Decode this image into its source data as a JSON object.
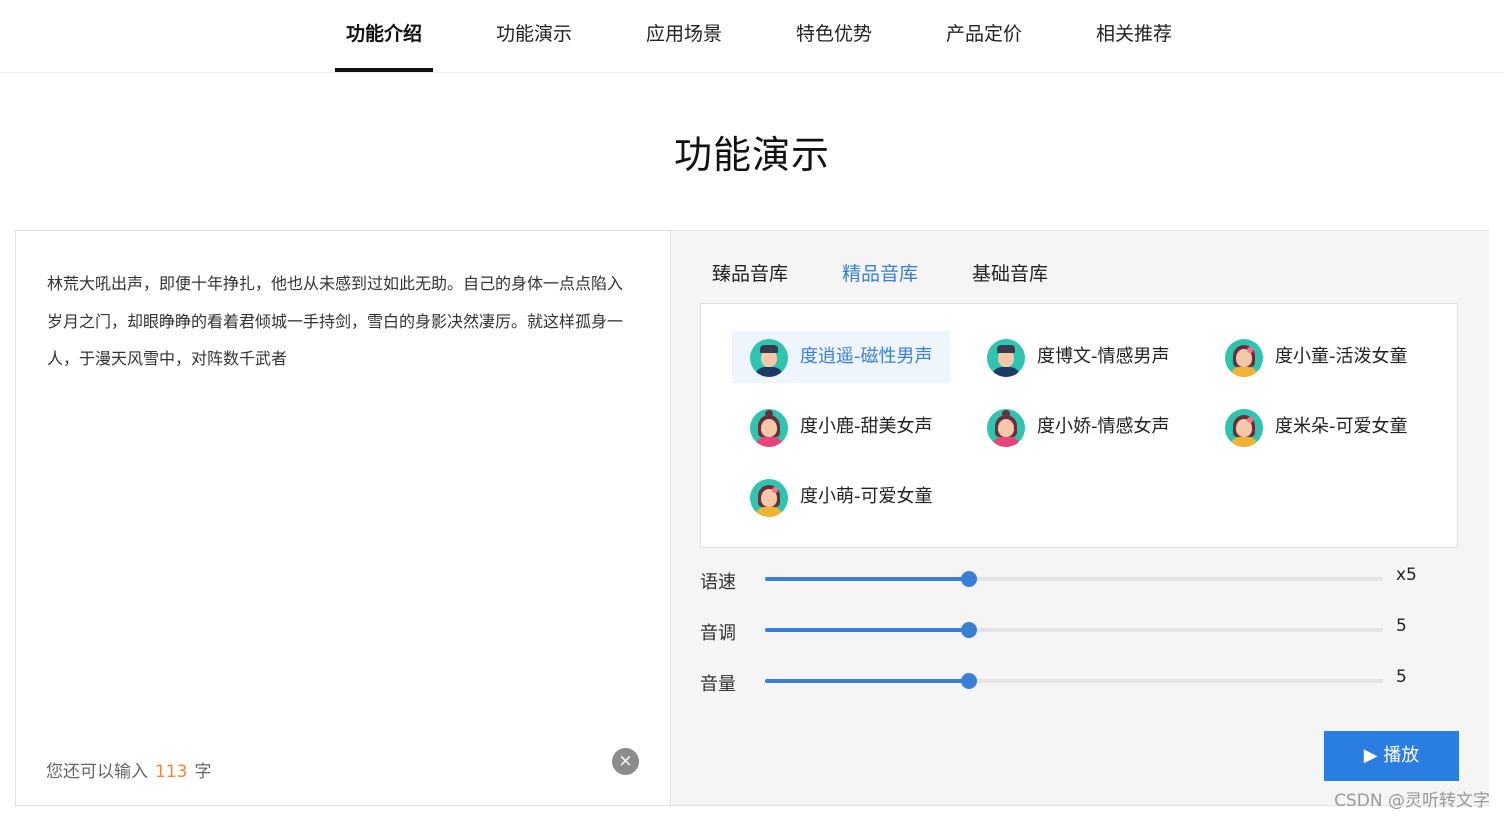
{
  "nav": {
    "items": [
      {
        "label": "功能介绍",
        "active": true
      },
      {
        "label": "功能演示",
        "active": false
      },
      {
        "label": "应用场景",
        "active": false
      },
      {
        "label": "特色优势",
        "active": false
      },
      {
        "label": "产品定价",
        "active": false
      },
      {
        "label": "相关推荐",
        "active": false
      }
    ]
  },
  "section": {
    "title": "功能演示"
  },
  "editor": {
    "text": "林荒大吼出声，即便十年挣扎，他也从未感到过如此无助。自己的身体一点点陷入岁月之门，却眼睁睁的看着君倾城一手持剑，雪白的身影决然凄厉。就这样孤身一人，于漫天风雪中，对阵数千武者",
    "counter_prefix": "您还可以输入",
    "counter_value": "113",
    "counter_suffix": "字",
    "clear_icon": "×"
  },
  "voice_tabs": [
    {
      "label": "臻品音库",
      "active": false
    },
    {
      "label": "精品音库",
      "active": true
    },
    {
      "label": "基础音库",
      "active": false
    }
  ],
  "voices": [
    {
      "name": "度逍遥-磁性男声",
      "avatar": "male-avatar",
      "selected": true
    },
    {
      "name": "度博文-情感男声",
      "avatar": "male-avatar",
      "selected": false
    },
    {
      "name": "度小童-活泼女童",
      "avatar": "girl-avatar",
      "selected": false
    },
    {
      "name": "度小鹿-甜美女声",
      "avatar": "female-avatar",
      "selected": false
    },
    {
      "name": "度小娇-情感女声",
      "avatar": "female-avatar",
      "selected": false
    },
    {
      "name": "度米朵-可爱女童",
      "avatar": "girl-avatar",
      "selected": false
    },
    {
      "name": "度小萌-可爱女童",
      "avatar": "girl-avatar",
      "selected": false
    }
  ],
  "sliders": [
    {
      "label": "语速",
      "value_text": "x5",
      "fraction": 0.33
    },
    {
      "label": "音调",
      "value_text": "5",
      "fraction": 0.33
    },
    {
      "label": "音量",
      "value_text": "5",
      "fraction": 0.33
    }
  ],
  "play": {
    "label": "▶ 播放"
  },
  "watermark": "CSDN @灵听转文字",
  "colors": {
    "accent": "#3a7fd6",
    "play_button": "#2a7de1",
    "counter_number": "#f0883a"
  }
}
